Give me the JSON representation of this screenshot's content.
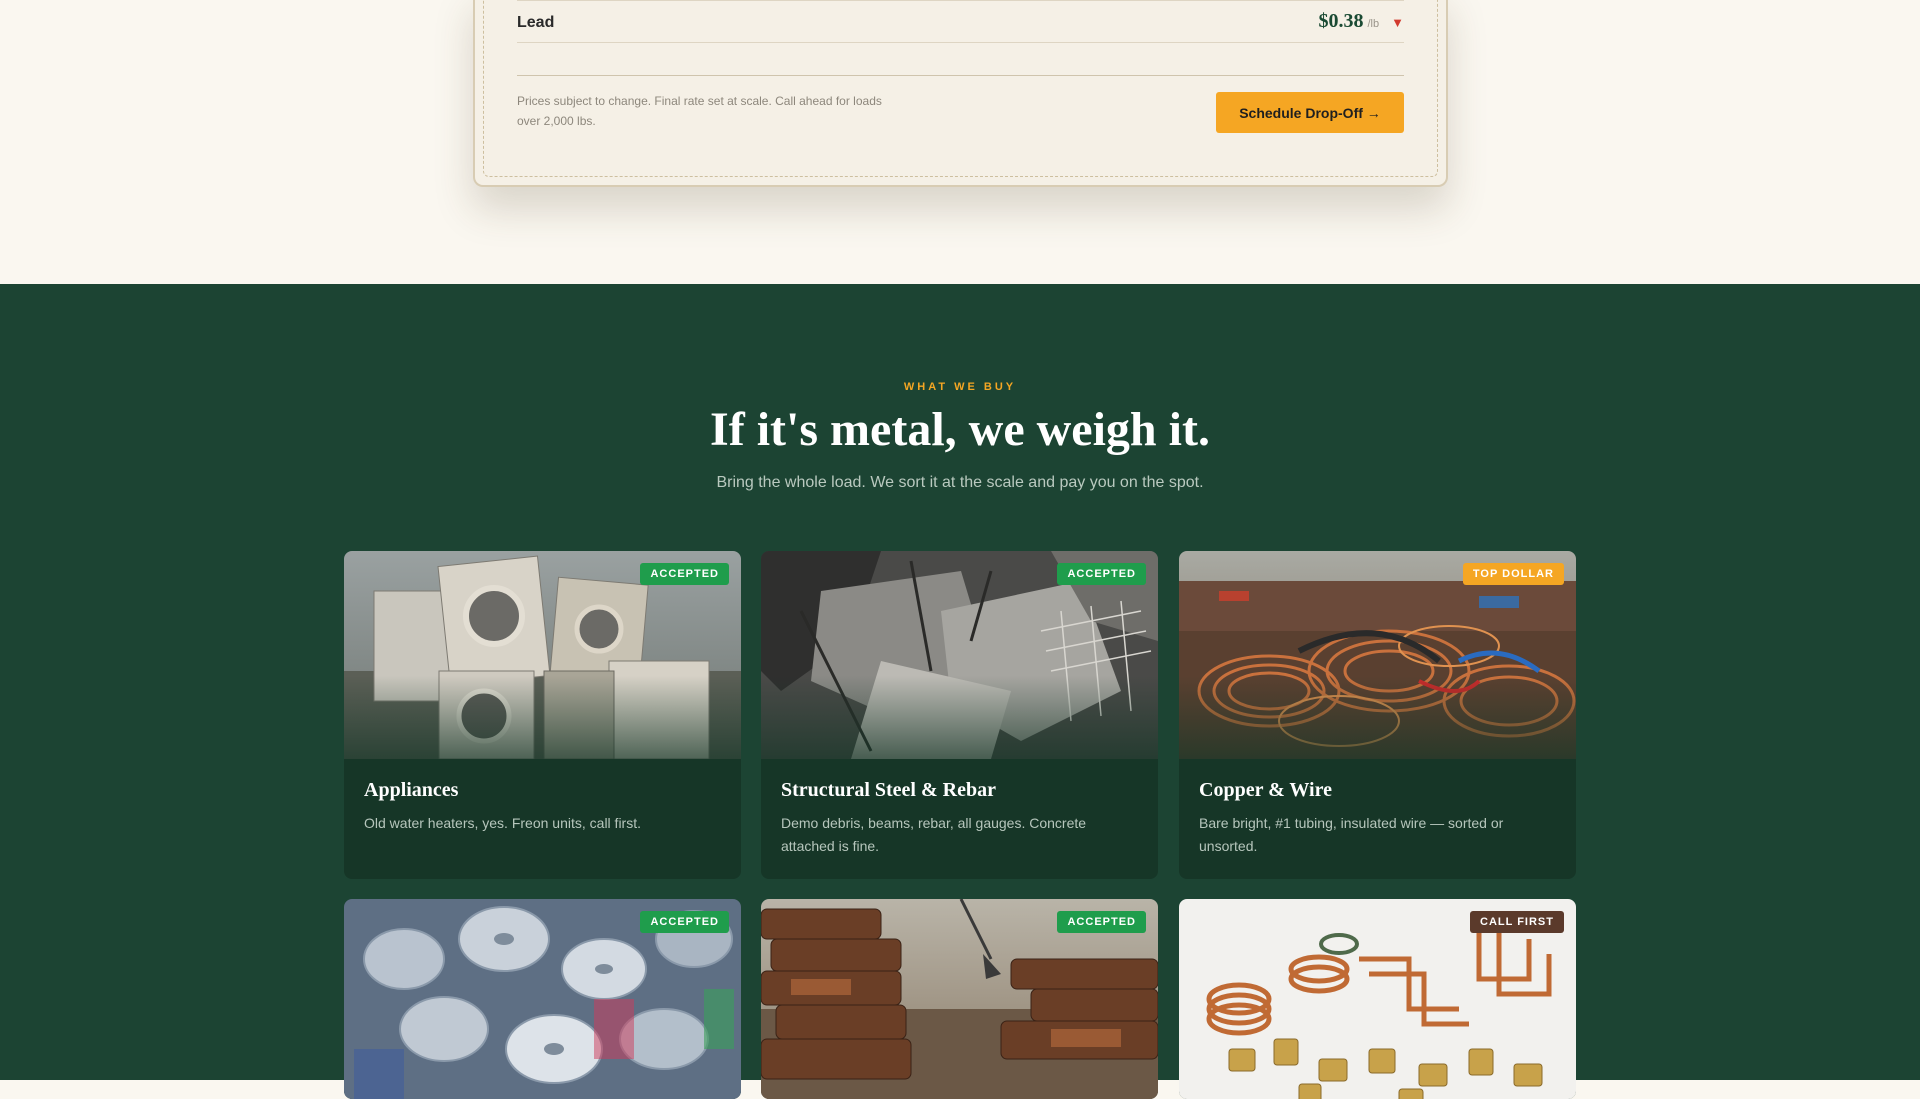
{
  "price_board": {
    "metal_name": "Lead",
    "price": "$0.38",
    "unit": "/lb",
    "trend_icon": "▼",
    "disclaimer": "Prices subject to change. Final rate set at scale. Call ahead for loads over 2,000 lbs.",
    "cta_label": "Schedule Drop-Off →"
  },
  "buy_section": {
    "eyebrow": "WHAT WE BUY",
    "headline": "If it's metal, we weigh it.",
    "subhead": "Bring the whole load. We sort it at the scale and pay you on the spot.",
    "cards": [
      {
        "title": "Appliances",
        "desc": "Old water heaters, yes. Freon units, call first.",
        "badge": "ACCEPTED"
      },
      {
        "title": "Structural Steel & Rebar",
        "desc": "Demo debris, beams, rebar, all gauges. Concrete attached is fine.",
        "badge": "ACCEPTED"
      },
      {
        "title": "Copper & Wire",
        "desc": "Bare bright, #1 tubing, insulated wire — sorted or unsorted.",
        "badge": "TOP DOLLAR"
      },
      {
        "title": "",
        "desc": "",
        "badge": "ACCEPTED"
      },
      {
        "title": "",
        "desc": "",
        "badge": "ACCEPTED"
      },
      {
        "title": "",
        "desc": "",
        "badge": "CALL FIRST"
      }
    ]
  },
  "colors": {
    "accent": "#f5a623",
    "section_bg": "#1c4433",
    "accepted_badge": "#1f9d4c",
    "call_first_badge": "#5b3a2b",
    "trend_down": "#d23a2e"
  }
}
